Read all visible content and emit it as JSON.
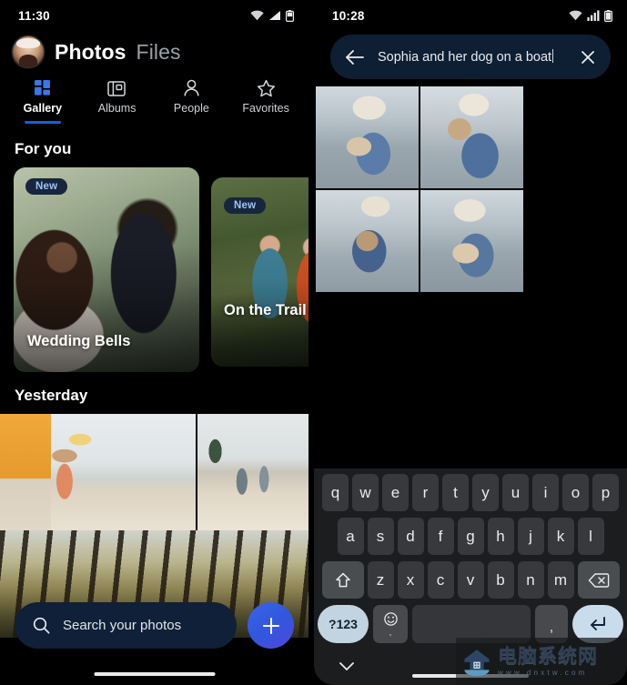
{
  "left_phone": {
    "status": {
      "time": "11:30",
      "icons": [
        "wifi-icon",
        "signal-icon",
        "battery-icon"
      ]
    },
    "header": {
      "avatar": "user-avatar",
      "title_active": "Photos",
      "title_inactive": "Files"
    },
    "tabs": [
      {
        "label": "Gallery",
        "icon": "grid-icon",
        "active": true
      },
      {
        "label": "Albums",
        "icon": "album-icon",
        "active": false
      },
      {
        "label": "People",
        "icon": "person-icon",
        "active": false
      },
      {
        "label": "Favorites",
        "icon": "star-icon",
        "active": false
      }
    ],
    "for_you": {
      "heading": "For you",
      "cards": [
        {
          "badge": "New",
          "title": "Wedding Bells"
        },
        {
          "badge": "New",
          "title": "On the Trail"
        }
      ]
    },
    "yesterday": {
      "heading": "Yesterday"
    },
    "dock": {
      "search_placeholder": "Search your photos",
      "search_icon": "search-icon",
      "fab_icon": "plus-icon"
    }
  },
  "right_phone": {
    "status": {
      "time": "10:28",
      "icons": [
        "wifi-icon",
        "signal-icon",
        "battery-icon"
      ]
    },
    "search": {
      "back_icon": "arrow-back-icon",
      "query": "Sophia and her dog on a boat",
      "clear_icon": "close-icon"
    },
    "results": {
      "count": 4
    },
    "keyboard": {
      "row1": [
        "q",
        "w",
        "e",
        "r",
        "t",
        "y",
        "u",
        "i",
        "o",
        "p"
      ],
      "row2": [
        "a",
        "s",
        "d",
        "f",
        "g",
        "h",
        "j",
        "k",
        "l"
      ],
      "row3_shift": "shift-icon",
      "row3": [
        "z",
        "x",
        "c",
        "v",
        "b",
        "n",
        "m"
      ],
      "row3_backspace": "backspace-icon",
      "symbols_key": "?123",
      "emoji_key": "emoji-icon",
      "space_key": "",
      "comma_key": ",",
      "enter_key": "enter-icon",
      "hide_key": "chevron-down-icon"
    }
  },
  "watermark": {
    "cn": "电脑系统网",
    "url": "www.dnxtw.com"
  },
  "colors": {
    "accent_blue": "#1a5fd6",
    "fab_blue": "#3b63e8",
    "search_navy": "#0f2038",
    "badge_bg": "#17263c",
    "badge_text": "#9fc3f5",
    "key_bg": "#37393c",
    "key_accent": "#c2d4e0"
  }
}
